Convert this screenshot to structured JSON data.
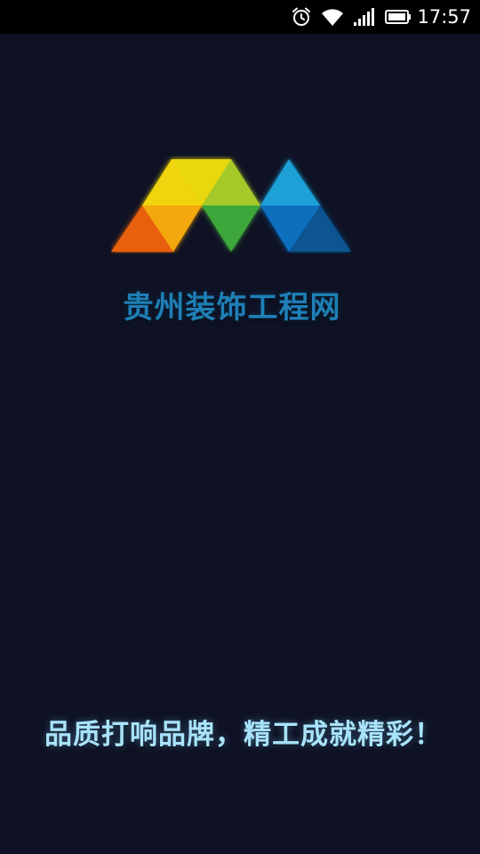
{
  "status_bar": {
    "time": "17:57",
    "icons": [
      "alarm-icon",
      "wifi-icon",
      "signal-icon",
      "battery-icon"
    ]
  },
  "splash": {
    "brand_name": "贵州装饰工程网",
    "slogan": "品质打响品牌，精工成就精彩！"
  },
  "colors": {
    "background": "#0f1224",
    "brand_text": "#1f7fb6",
    "slogan_text": "#a9e3fb",
    "logo_orange": "#e8600f",
    "logo_amber": "#f4a80d",
    "logo_yellow": "#f0d40f",
    "logo_lime": "#a6c92c",
    "logo_green": "#3da73a",
    "logo_sky": "#1ea0d6",
    "logo_blue": "#0a6fbe",
    "logo_navy": "#0f5590"
  }
}
